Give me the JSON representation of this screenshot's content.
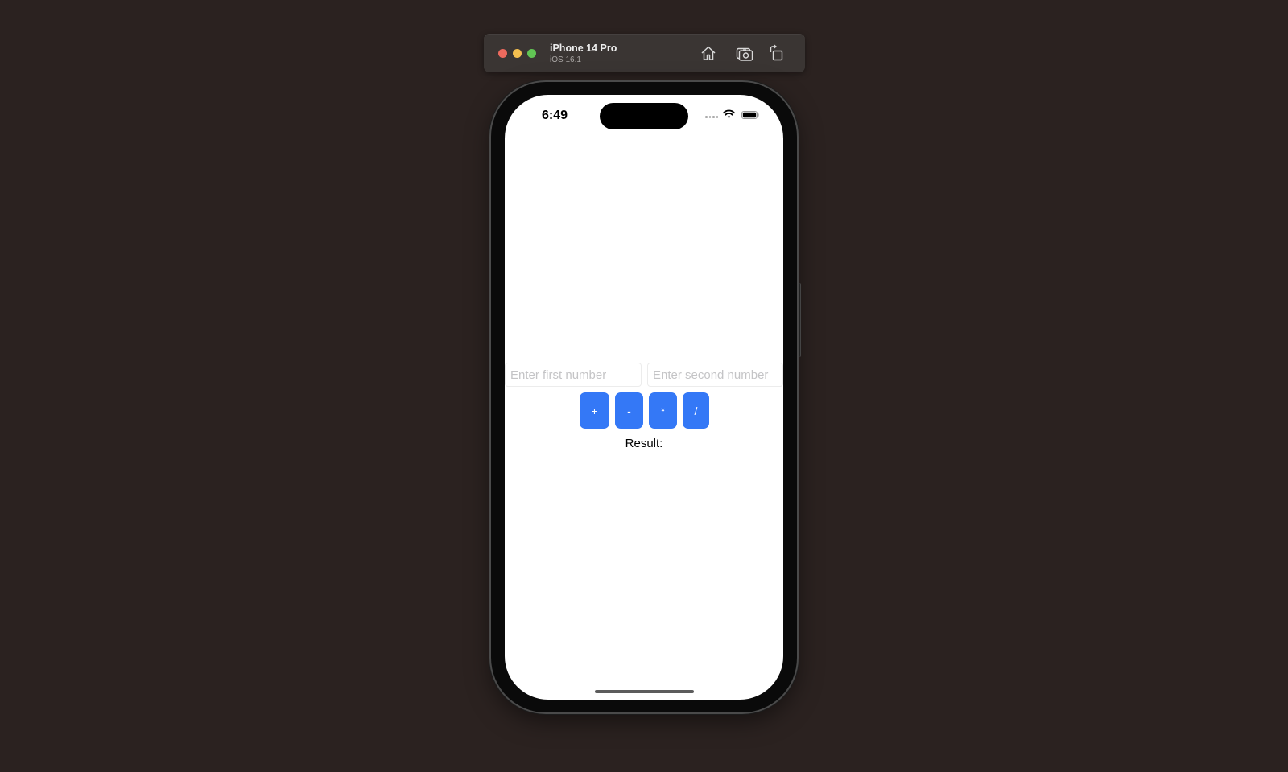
{
  "simulator": {
    "device_name": "iPhone 14 Pro",
    "os_version": "iOS 16.1",
    "toolbar_icons": [
      "home-icon",
      "screenshot-icon",
      "rotate-icon"
    ]
  },
  "status_bar": {
    "time": "6:49",
    "icons": [
      "cellular-dots-icon",
      "wifi-icon",
      "battery-icon"
    ]
  },
  "app": {
    "first_input": {
      "value": "",
      "placeholder": "Enter first number"
    },
    "second_input": {
      "value": "",
      "placeholder": "Enter second number"
    },
    "operations": [
      {
        "label": "+"
      },
      {
        "label": "-"
      },
      {
        "label": "*"
      },
      {
        "label": "/"
      }
    ],
    "result_label": "Result:",
    "accent_color": "#3478f6"
  }
}
